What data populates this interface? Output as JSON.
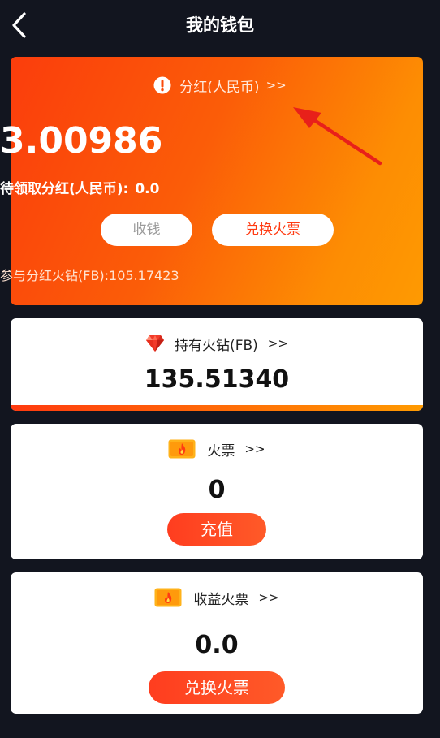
{
  "header": {
    "title": "我的钱包"
  },
  "dividend": {
    "title": "分红(人民币)",
    "more": ">>",
    "amount": "3.00986",
    "pending_label": "待领取分红(人民币):",
    "pending_value": "0.0",
    "collect_label": "收钱",
    "exchange_label": "兑换火票",
    "participation_text": "参与分红火钻(FB):105.17423"
  },
  "diamond": {
    "title": "持有火钻(FB)",
    "more": ">>",
    "amount": "135.51340",
    "progress": 1.0
  },
  "ticket": {
    "title": "火票",
    "more": ">>",
    "amount": "0",
    "recharge_label": "充值"
  },
  "earnings": {
    "title": "收益火票",
    "more": ">>",
    "amount": "0.0",
    "exchange_label": "兑换火票"
  },
  "icons": {
    "back": "chevron-left-icon",
    "alert": "exclamation-circle-icon",
    "diamond": "red-diamond-icon",
    "ticket": "fire-ticket-icon"
  },
  "colors": {
    "background": "#12151f",
    "accent_red": "#ff3d1f",
    "gradient_start": "#fb3d0c",
    "gradient_end": "#fe9a02",
    "annotation_arrow": "#e8201a"
  }
}
